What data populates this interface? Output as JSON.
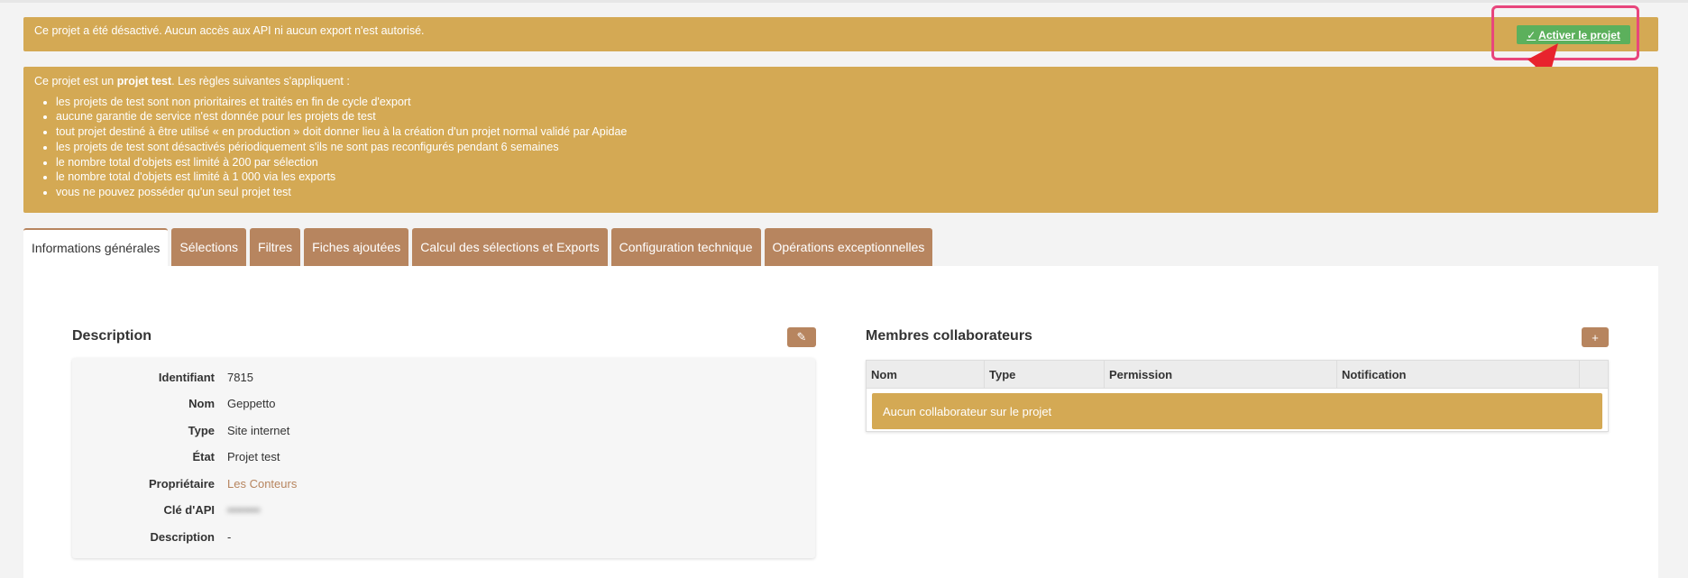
{
  "alerts": {
    "deactivated": {
      "text": "Ce projet a été désactivé. Aucun accès aux API ni aucun export n'est autorisé.",
      "button_label": "Activer le projet"
    },
    "test_project": {
      "intro_before": "Ce projet est un ",
      "intro_bold": "projet test",
      "intro_after": ". Les règles suivantes s'appliquent :",
      "rules": [
        "les projets de test sont non prioritaires et traités en fin de cycle d'export",
        "aucune garantie de service n'est donnée pour les projets de test",
        "tout projet destiné à être utilisé « en production » doit donner lieu à la création d'un projet normal validé par Apidae",
        "les projets de test sont désactivés périodiquement s'ils ne sont pas reconfigurés pendant 6 semaines",
        "le nombre total d'objets est limité à 200 par sélection",
        "le nombre total d'objets est limité à 1 000 via les exports",
        "vous ne pouvez posséder qu'un seul projet test"
      ]
    }
  },
  "tabs": [
    {
      "label": "Informations générales",
      "active": true
    },
    {
      "label": "Sélections"
    },
    {
      "label": "Filtres"
    },
    {
      "label": "Fiches ajoutées"
    },
    {
      "label": "Calcul des sélections et Exports"
    },
    {
      "label": "Configuration technique"
    },
    {
      "label": "Opérations exceptionnelles"
    }
  ],
  "description": {
    "title": "Description",
    "edit_icon": "pencil-icon",
    "rows": [
      {
        "label": "Identifiant",
        "value": "7815"
      },
      {
        "label": "Nom",
        "value": "Geppetto"
      },
      {
        "label": "Type",
        "value": "Site internet"
      },
      {
        "label": "État",
        "value": "Projet test"
      },
      {
        "label": "Propriétaire",
        "value": "Les Conteurs"
      },
      {
        "label": "Clé d'API",
        "value": "••••••••"
      },
      {
        "label": "Description",
        "value": "-"
      }
    ]
  },
  "members": {
    "title": "Membres collaborateurs",
    "add_icon": "plus-icon",
    "columns": [
      "Nom",
      "Type",
      "Permission",
      "Notification"
    ],
    "empty_text": "Aucun collaborateur sur le projet"
  },
  "colors": {
    "warning": "#d4a954",
    "tab": "#b7855f",
    "success": "#5cb05c",
    "highlight": "#e8467c",
    "arrow": "#e8232d"
  }
}
